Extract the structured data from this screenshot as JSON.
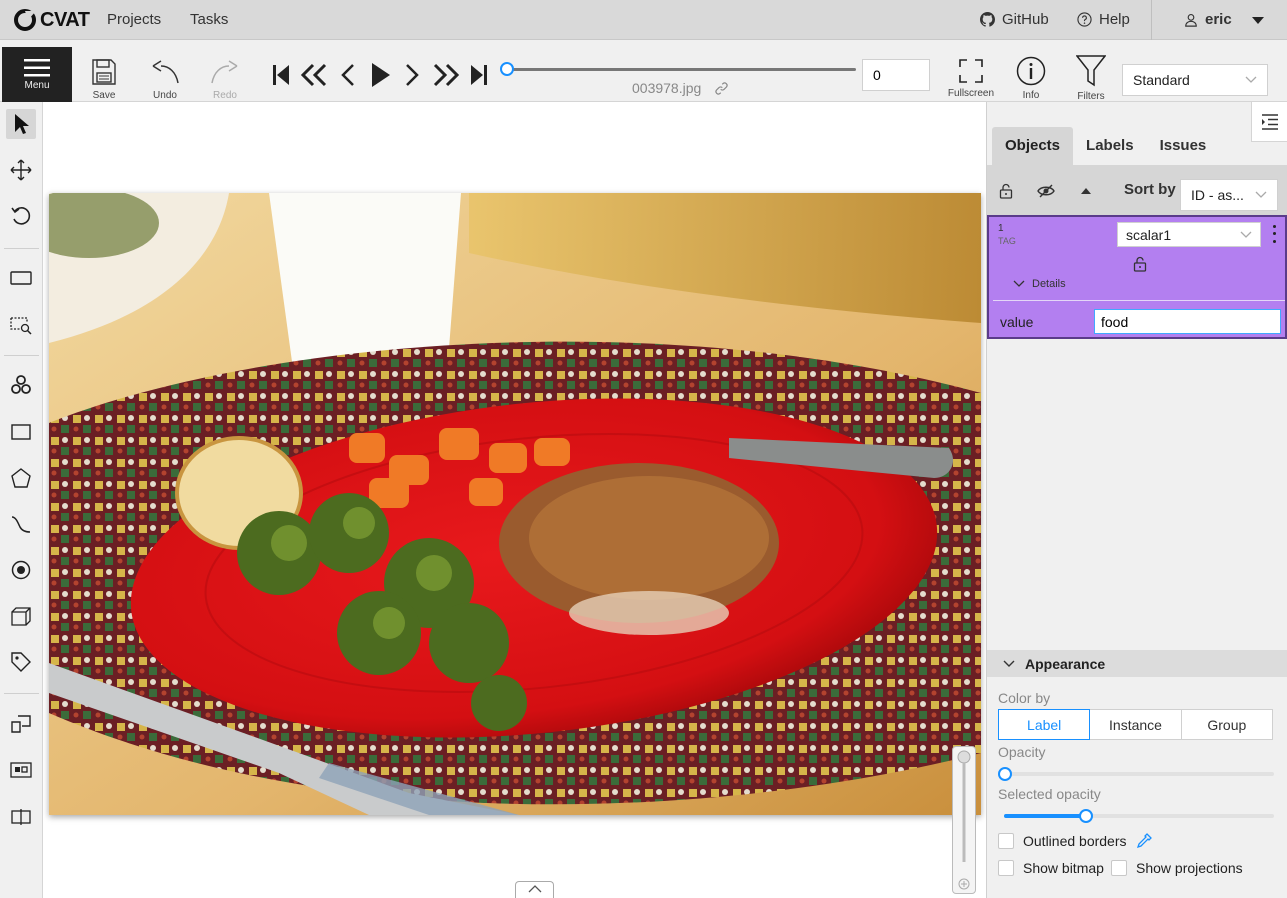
{
  "topnav": {
    "logo_text": "CVAT",
    "projects": "Projects",
    "tasks": "Tasks",
    "github": "GitHub",
    "help": "Help",
    "user": "eric"
  },
  "toolbar": {
    "menu_label": "Menu",
    "save_label": "Save",
    "undo_label": "Undo",
    "redo_label": "Redo",
    "filename": "003978.jpg",
    "frame_number": "0",
    "fullscreen_label": "Fullscreen",
    "info_label": "Info",
    "filters_label": "Filters",
    "workspace": "Standard"
  },
  "sidebar": {
    "tabs": [
      "Objects",
      "Labels",
      "Issues"
    ],
    "sort_by_label": "Sort by",
    "sort_by_value": "ID - as...",
    "object": {
      "id": "1",
      "type": "TAG",
      "label": "scalar1",
      "details_label": "Details",
      "attribute_name": "value",
      "attribute_value": "food",
      "color": "#b37ff0"
    }
  },
  "appearance": {
    "title": "Appearance",
    "color_by_label": "Color by",
    "color_by_options": [
      "Label",
      "Instance",
      "Group"
    ],
    "color_by_selected": "Label",
    "opacity_label": "Opacity",
    "opacity_value": 0.0,
    "selected_opacity_label": "Selected opacity",
    "selected_opacity_value": 0.3,
    "outlined_borders_label": "Outlined borders",
    "show_bitmap_label": "Show bitmap",
    "show_projections_label": "Show projections"
  },
  "icons": {
    "accent": "#1890ff"
  }
}
